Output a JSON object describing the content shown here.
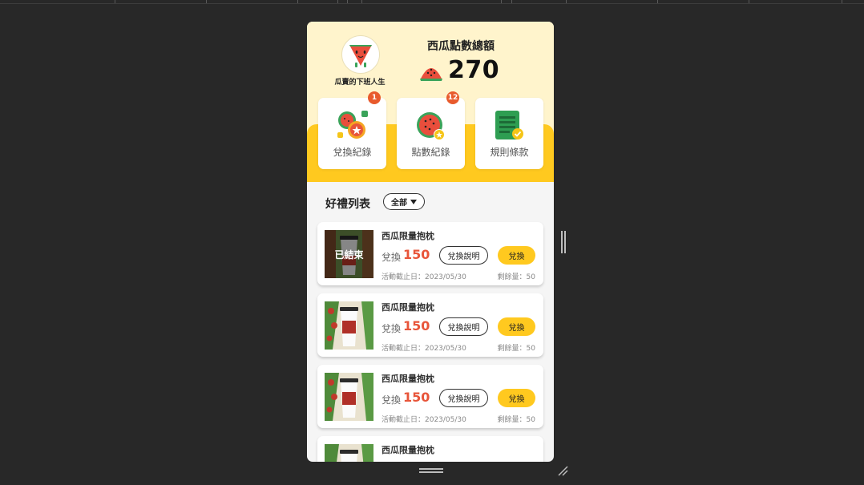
{
  "user": {
    "name": "瓜賣的下班人生"
  },
  "points": {
    "title": "西瓜點數總額",
    "value": "270"
  },
  "menu": [
    {
      "label": "兌換紀錄",
      "badge": "1",
      "icon": "exchange-record-icon"
    },
    {
      "label": "點數紀錄",
      "badge": "12",
      "icon": "points-record-icon"
    },
    {
      "label": "規則條款",
      "badge": "",
      "icon": "rules-terms-icon"
    }
  ],
  "gifts": {
    "title": "好禮列表",
    "filter": "全部",
    "items": [
      {
        "name": "西瓜限量抱枕",
        "exchange_label": "兌換",
        "points": "150",
        "desc_button": "兌換說明",
        "redeem_button": "兌換",
        "deadline": "活動截止日：2023/05/30",
        "remaining": "剩餘量：50",
        "ended": "已結束"
      },
      {
        "name": "西瓜限量抱枕",
        "exchange_label": "兌換",
        "points": "150",
        "desc_button": "兌換說明",
        "redeem_button": "兌換",
        "deadline": "活動截止日：2023/05/30",
        "remaining": "剩餘量：50",
        "ended": ""
      },
      {
        "name": "西瓜限量抱枕",
        "exchange_label": "兌換",
        "points": "150",
        "desc_button": "兌換說明",
        "redeem_button": "兌換",
        "deadline": "活動截止日：2023/05/30",
        "remaining": "剩餘量：50",
        "ended": ""
      },
      {
        "name": "西瓜限量抱枕",
        "exchange_label": "",
        "points": "",
        "desc_button": "",
        "redeem_button": "",
        "deadline": "",
        "remaining": "",
        "ended": ""
      }
    ]
  },
  "colors": {
    "accent": "#ffc91f",
    "header": "#fff4cc",
    "points": "#e8553a",
    "badge": "#e85a2c"
  }
}
